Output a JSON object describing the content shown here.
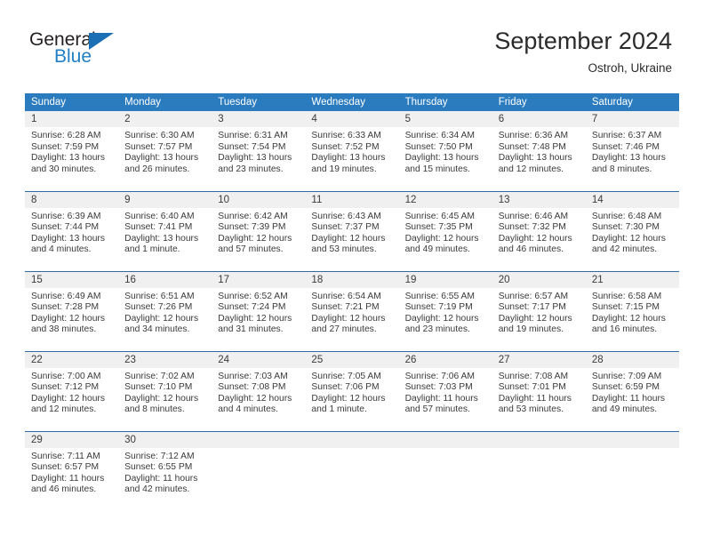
{
  "brand": {
    "name_top": "General",
    "name_bottom": "Blue",
    "accent_color": "#1a6fb5"
  },
  "header": {
    "title": "September 2024",
    "location": "Ostroh, Ukraine"
  },
  "theme": {
    "header_blue": "#2b7cbf",
    "separator_blue": "#2b6ba8",
    "daynum_band": "#f0f0f0",
    "text": "#3a3a3a"
  },
  "weekday_headers": [
    "Sunday",
    "Monday",
    "Tuesday",
    "Wednesday",
    "Thursday",
    "Friday",
    "Saturday"
  ],
  "weeks": [
    [
      {
        "day": "1",
        "sunrise": "Sunrise: 6:28 AM",
        "sunset": "Sunset: 7:59 PM",
        "daylight_1": "Daylight: 13 hours",
        "daylight_2": "and 30 minutes."
      },
      {
        "day": "2",
        "sunrise": "Sunrise: 6:30 AM",
        "sunset": "Sunset: 7:57 PM",
        "daylight_1": "Daylight: 13 hours",
        "daylight_2": "and 26 minutes."
      },
      {
        "day": "3",
        "sunrise": "Sunrise: 6:31 AM",
        "sunset": "Sunset: 7:54 PM",
        "daylight_1": "Daylight: 13 hours",
        "daylight_2": "and 23 minutes."
      },
      {
        "day": "4",
        "sunrise": "Sunrise: 6:33 AM",
        "sunset": "Sunset: 7:52 PM",
        "daylight_1": "Daylight: 13 hours",
        "daylight_2": "and 19 minutes."
      },
      {
        "day": "5",
        "sunrise": "Sunrise: 6:34 AM",
        "sunset": "Sunset: 7:50 PM",
        "daylight_1": "Daylight: 13 hours",
        "daylight_2": "and 15 minutes."
      },
      {
        "day": "6",
        "sunrise": "Sunrise: 6:36 AM",
        "sunset": "Sunset: 7:48 PM",
        "daylight_1": "Daylight: 13 hours",
        "daylight_2": "and 12 minutes."
      },
      {
        "day": "7",
        "sunrise": "Sunrise: 6:37 AM",
        "sunset": "Sunset: 7:46 PM",
        "daylight_1": "Daylight: 13 hours",
        "daylight_2": "and 8 minutes."
      }
    ],
    [
      {
        "day": "8",
        "sunrise": "Sunrise: 6:39 AM",
        "sunset": "Sunset: 7:44 PM",
        "daylight_1": "Daylight: 13 hours",
        "daylight_2": "and 4 minutes."
      },
      {
        "day": "9",
        "sunrise": "Sunrise: 6:40 AM",
        "sunset": "Sunset: 7:41 PM",
        "daylight_1": "Daylight: 13 hours",
        "daylight_2": "and 1 minute."
      },
      {
        "day": "10",
        "sunrise": "Sunrise: 6:42 AM",
        "sunset": "Sunset: 7:39 PM",
        "daylight_1": "Daylight: 12 hours",
        "daylight_2": "and 57 minutes."
      },
      {
        "day": "11",
        "sunrise": "Sunrise: 6:43 AM",
        "sunset": "Sunset: 7:37 PM",
        "daylight_1": "Daylight: 12 hours",
        "daylight_2": "and 53 minutes."
      },
      {
        "day": "12",
        "sunrise": "Sunrise: 6:45 AM",
        "sunset": "Sunset: 7:35 PM",
        "daylight_1": "Daylight: 12 hours",
        "daylight_2": "and 49 minutes."
      },
      {
        "day": "13",
        "sunrise": "Sunrise: 6:46 AM",
        "sunset": "Sunset: 7:32 PM",
        "daylight_1": "Daylight: 12 hours",
        "daylight_2": "and 46 minutes."
      },
      {
        "day": "14",
        "sunrise": "Sunrise: 6:48 AM",
        "sunset": "Sunset: 7:30 PM",
        "daylight_1": "Daylight: 12 hours",
        "daylight_2": "and 42 minutes."
      }
    ],
    [
      {
        "day": "15",
        "sunrise": "Sunrise: 6:49 AM",
        "sunset": "Sunset: 7:28 PM",
        "daylight_1": "Daylight: 12 hours",
        "daylight_2": "and 38 minutes."
      },
      {
        "day": "16",
        "sunrise": "Sunrise: 6:51 AM",
        "sunset": "Sunset: 7:26 PM",
        "daylight_1": "Daylight: 12 hours",
        "daylight_2": "and 34 minutes."
      },
      {
        "day": "17",
        "sunrise": "Sunrise: 6:52 AM",
        "sunset": "Sunset: 7:24 PM",
        "daylight_1": "Daylight: 12 hours",
        "daylight_2": "and 31 minutes."
      },
      {
        "day": "18",
        "sunrise": "Sunrise: 6:54 AM",
        "sunset": "Sunset: 7:21 PM",
        "daylight_1": "Daylight: 12 hours",
        "daylight_2": "and 27 minutes."
      },
      {
        "day": "19",
        "sunrise": "Sunrise: 6:55 AM",
        "sunset": "Sunset: 7:19 PM",
        "daylight_1": "Daylight: 12 hours",
        "daylight_2": "and 23 minutes."
      },
      {
        "day": "20",
        "sunrise": "Sunrise: 6:57 AM",
        "sunset": "Sunset: 7:17 PM",
        "daylight_1": "Daylight: 12 hours",
        "daylight_2": "and 19 minutes."
      },
      {
        "day": "21",
        "sunrise": "Sunrise: 6:58 AM",
        "sunset": "Sunset: 7:15 PM",
        "daylight_1": "Daylight: 12 hours",
        "daylight_2": "and 16 minutes."
      }
    ],
    [
      {
        "day": "22",
        "sunrise": "Sunrise: 7:00 AM",
        "sunset": "Sunset: 7:12 PM",
        "daylight_1": "Daylight: 12 hours",
        "daylight_2": "and 12 minutes."
      },
      {
        "day": "23",
        "sunrise": "Sunrise: 7:02 AM",
        "sunset": "Sunset: 7:10 PM",
        "daylight_1": "Daylight: 12 hours",
        "daylight_2": "and 8 minutes."
      },
      {
        "day": "24",
        "sunrise": "Sunrise: 7:03 AM",
        "sunset": "Sunset: 7:08 PM",
        "daylight_1": "Daylight: 12 hours",
        "daylight_2": "and 4 minutes."
      },
      {
        "day": "25",
        "sunrise": "Sunrise: 7:05 AM",
        "sunset": "Sunset: 7:06 PM",
        "daylight_1": "Daylight: 12 hours",
        "daylight_2": "and 1 minute."
      },
      {
        "day": "26",
        "sunrise": "Sunrise: 7:06 AM",
        "sunset": "Sunset: 7:03 PM",
        "daylight_1": "Daylight: 11 hours",
        "daylight_2": "and 57 minutes."
      },
      {
        "day": "27",
        "sunrise": "Sunrise: 7:08 AM",
        "sunset": "Sunset: 7:01 PM",
        "daylight_1": "Daylight: 11 hours",
        "daylight_2": "and 53 minutes."
      },
      {
        "day": "28",
        "sunrise": "Sunrise: 7:09 AM",
        "sunset": "Sunset: 6:59 PM",
        "daylight_1": "Daylight: 11 hours",
        "daylight_2": "and 49 minutes."
      }
    ],
    [
      {
        "day": "29",
        "sunrise": "Sunrise: 7:11 AM",
        "sunset": "Sunset: 6:57 PM",
        "daylight_1": "Daylight: 11 hours",
        "daylight_2": "and 46 minutes."
      },
      {
        "day": "30",
        "sunrise": "Sunrise: 7:12 AM",
        "sunset": "Sunset: 6:55 PM",
        "daylight_1": "Daylight: 11 hours",
        "daylight_2": "and 42 minutes."
      },
      {
        "day": "",
        "sunrise": "",
        "sunset": "",
        "daylight_1": "",
        "daylight_2": ""
      },
      {
        "day": "",
        "sunrise": "",
        "sunset": "",
        "daylight_1": "",
        "daylight_2": ""
      },
      {
        "day": "",
        "sunrise": "",
        "sunset": "",
        "daylight_1": "",
        "daylight_2": ""
      },
      {
        "day": "",
        "sunrise": "",
        "sunset": "",
        "daylight_1": "",
        "daylight_2": ""
      },
      {
        "day": "",
        "sunrise": "",
        "sunset": "",
        "daylight_1": "",
        "daylight_2": ""
      }
    ]
  ]
}
